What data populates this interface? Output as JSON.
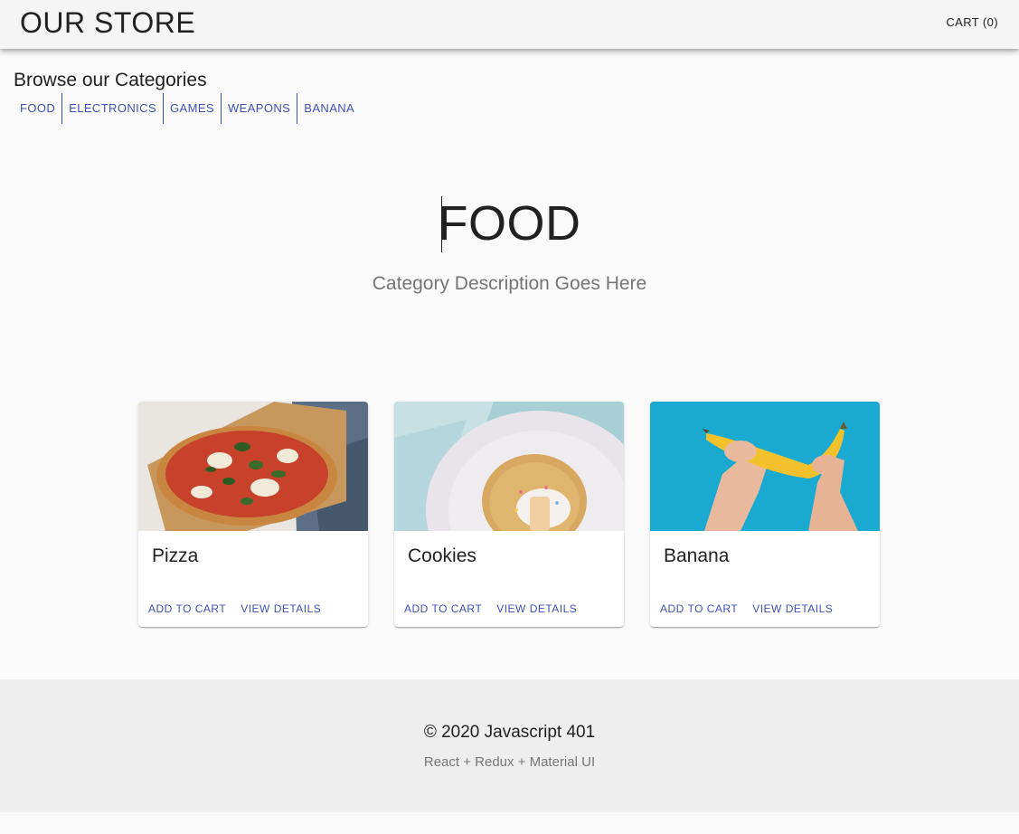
{
  "header": {
    "title": "OUR STORE",
    "cart_label": "CART (0)"
  },
  "categories": {
    "heading": "Browse our Categories",
    "items": [
      {
        "label": "FOOD"
      },
      {
        "label": "ELECTRONICS"
      },
      {
        "label": "GAMES"
      },
      {
        "label": "WEAPONS"
      },
      {
        "label": "BANANA"
      }
    ]
  },
  "hero": {
    "title": "FOOD",
    "description": "Category Description Goes Here"
  },
  "products": [
    {
      "name": "Pizza",
      "add_label": "ADD TO CART",
      "details_label": "VIEW DETAILS",
      "image": "pizza-photo"
    },
    {
      "name": "Cookies",
      "add_label": "ADD TO CART",
      "details_label": "VIEW DETAILS",
      "image": "cookie-photo"
    },
    {
      "name": "Banana",
      "add_label": "ADD TO CART",
      "details_label": "VIEW DETAILS",
      "image": "banana-photo"
    }
  ],
  "footer": {
    "copyright": "© 2020 Javascript 401",
    "subtitle": "React + Redux + Material UI"
  },
  "colors": {
    "primary": "#3f51b5",
    "appbar": "#f5f5f5",
    "background": "#fafafa",
    "footer": "#eeeeee"
  }
}
